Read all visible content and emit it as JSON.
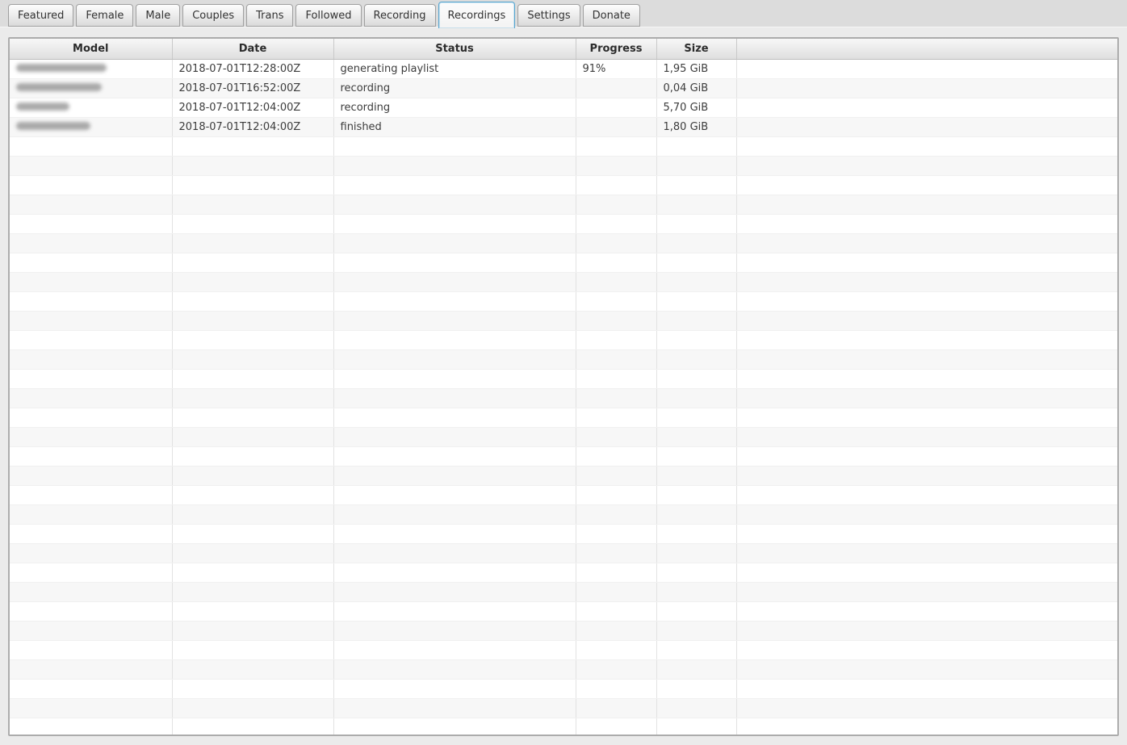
{
  "tabs": {
    "items": [
      {
        "label": "Featured",
        "selected": false
      },
      {
        "label": "Female",
        "selected": false
      },
      {
        "label": "Male",
        "selected": false
      },
      {
        "label": "Couples",
        "selected": false
      },
      {
        "label": "Trans",
        "selected": false
      },
      {
        "label": "Followed",
        "selected": false
      },
      {
        "label": "Recording",
        "selected": false
      },
      {
        "label": "Recordings",
        "selected": true
      },
      {
        "label": "Settings",
        "selected": false
      },
      {
        "label": "Donate",
        "selected": false
      }
    ]
  },
  "table": {
    "columns": [
      "Model",
      "Date",
      "Status",
      "Progress",
      "Size",
      ""
    ],
    "rows": [
      {
        "model_redacted": true,
        "blob_style": "width:112px",
        "date": "2018-07-01T12:28:00Z",
        "status": "generating playlist",
        "progress": "91%",
        "size": "1,95 GiB"
      },
      {
        "model_redacted": true,
        "blob_style": "width:106px",
        "date": "2018-07-01T16:52:00Z",
        "status": "recording",
        "progress": "",
        "size": "0,04 GiB"
      },
      {
        "model_redacted": true,
        "blob_style": "width:66px",
        "date": "2018-07-01T12:04:00Z",
        "status": "recording",
        "progress": "",
        "size": "5,70 GiB"
      },
      {
        "model_redacted": true,
        "blob_style": "width:92px",
        "date": "2018-07-01T12:04:00Z",
        "status": "finished",
        "progress": "",
        "size": "1,80 GiB"
      }
    ],
    "empty_row_count": 31
  },
  "colors": {
    "selected_tab_border": "#57a5cf",
    "window_background": "#ebebeb",
    "tabbar_background": "#dcdcdc",
    "row_stripe": "#f7f7f7",
    "table_border": "#acacac",
    "header_text": "#2b2b2b",
    "cell_text": "#3c3c3c"
  }
}
